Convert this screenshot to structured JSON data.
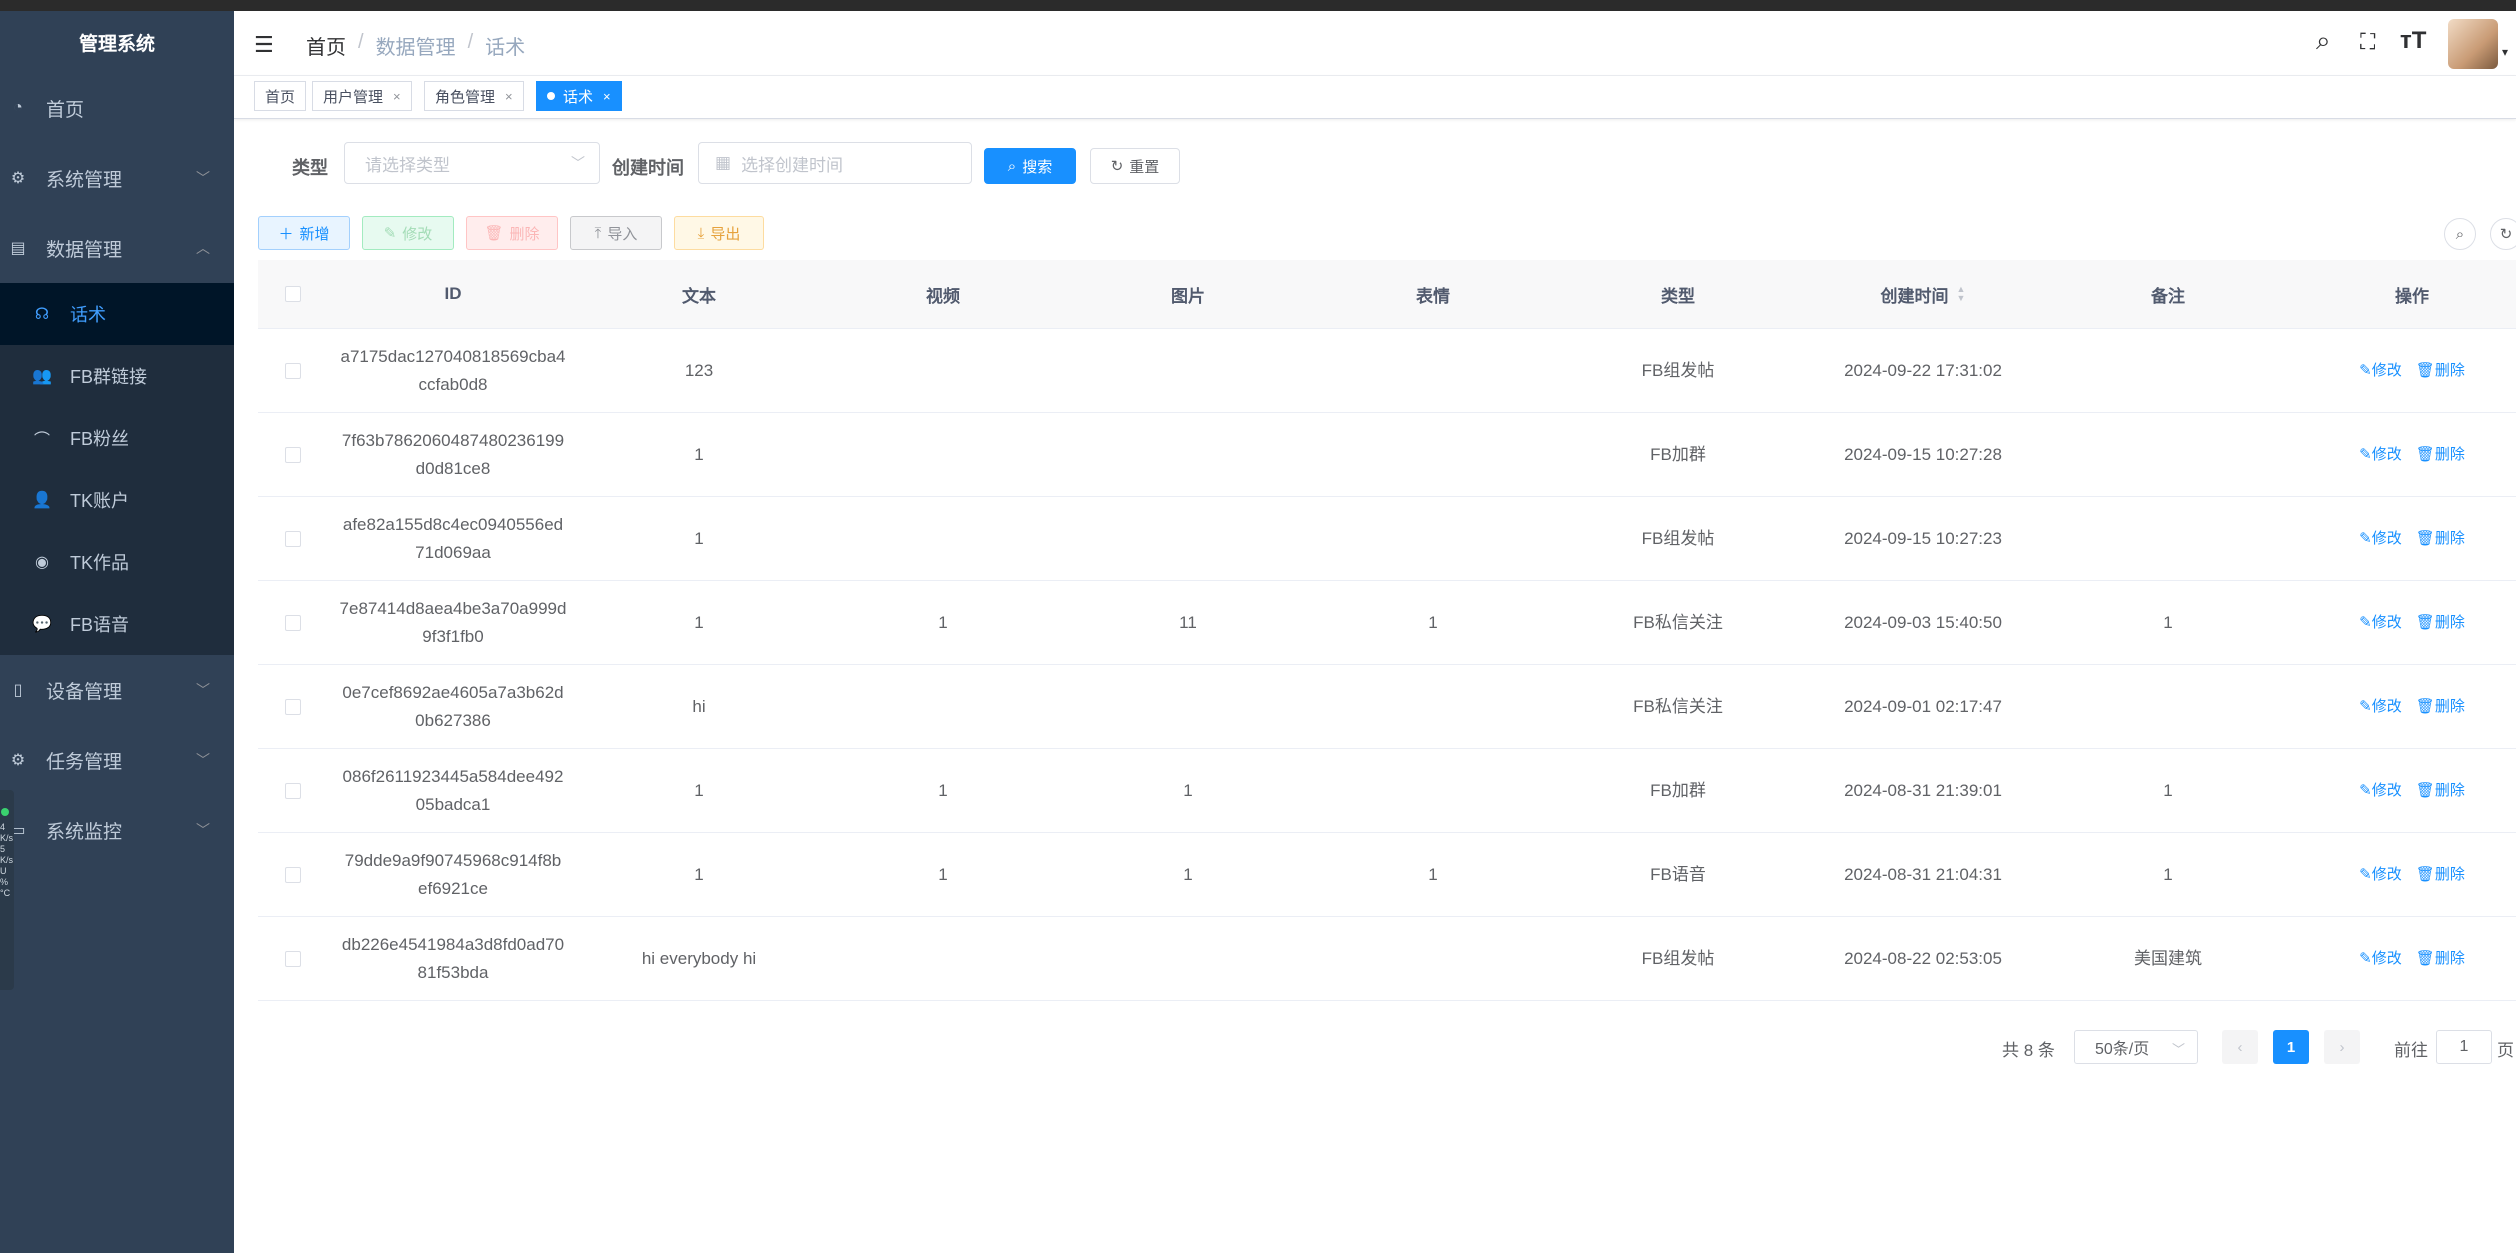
{
  "sidebar": {
    "logo": "管理系统",
    "items": [
      {
        "label": "首页",
        "icon": "dashboard-icon"
      },
      {
        "label": "系统管理",
        "icon": "gear-icon"
      },
      {
        "label": "数据管理",
        "icon": "database-icon"
      },
      {
        "label": "设备管理",
        "icon": "phone-icon"
      },
      {
        "label": "任务管理",
        "icon": "gear-icon"
      },
      {
        "label": "系统监控",
        "icon": "monitor-icon"
      }
    ],
    "submenu": [
      {
        "label": "话术",
        "icon": "chat-icon"
      },
      {
        "label": "FB群链接",
        "icon": "users-icon"
      },
      {
        "label": "FB粉丝",
        "icon": "link-icon"
      },
      {
        "label": "TK账户",
        "icon": "user-icon"
      },
      {
        "label": "TK作品",
        "icon": "eye-icon"
      },
      {
        "label": "FB语音",
        "icon": "chat-bubbles-icon"
      }
    ],
    "widget_lines": [
      "4",
      "K/s",
      "5",
      "K/s",
      "U",
      "%",
      "°C"
    ]
  },
  "header": {
    "breadcrumb": [
      "首页",
      "数据管理",
      "话术"
    ]
  },
  "tags": [
    {
      "label": "首页"
    },
    {
      "label": "用户管理",
      "close": "×"
    },
    {
      "label": "角色管理",
      "close": "×"
    },
    {
      "label": "话术",
      "close": "×"
    }
  ],
  "search": {
    "type_label": "类型",
    "type_placeholder": "请选择类型",
    "time_label": "创建时间",
    "time_placeholder": "选择创建时间",
    "search_btn": "搜索",
    "reset_btn": "重置"
  },
  "toolbar": {
    "add": "新增",
    "edit": "修改",
    "delete": "删除",
    "import": "导入",
    "export": "导出"
  },
  "table": {
    "headers": [
      "ID",
      "文本",
      "视频",
      "图片",
      "表情",
      "类型",
      "创建时间",
      "备注",
      "操作"
    ],
    "edit_label": "修改",
    "delete_label": "删除",
    "rows": [
      {
        "id1": "a7175dac127040818569cba4",
        "id2": "ccfab0d8",
        "text": "123",
        "video": "",
        "image": "",
        "emoji": "",
        "type": "FB组发帖",
        "time": "2024-09-22 17:31:02",
        "note": ""
      },
      {
        "id1": "7f63b7862060487480236199",
        "id2": "d0d81ce8",
        "text": "1",
        "video": "",
        "image": "",
        "emoji": "",
        "type": "FB加群",
        "time": "2024-09-15 10:27:28",
        "note": ""
      },
      {
        "id1": "afe82a155d8c4ec0940556ed",
        "id2": "71d069aa",
        "text": "1",
        "video": "",
        "image": "",
        "emoji": "",
        "type": "FB组发帖",
        "time": "2024-09-15 10:27:23",
        "note": ""
      },
      {
        "id1": "7e87414d8aea4be3a70a999d",
        "id2": "9f3f1fb0",
        "text": "1",
        "video": "1",
        "image": "11",
        "emoji": "1",
        "type": "FB私信关注",
        "time": "2024-09-03 15:40:50",
        "note": "1"
      },
      {
        "id1": "0e7cef8692ae4605a7a3b62d",
        "id2": "0b627386",
        "text": "hi",
        "video": "",
        "image": "",
        "emoji": "",
        "type": "FB私信关注",
        "time": "2024-09-01 02:17:47",
        "note": ""
      },
      {
        "id1": "086f2611923445a584dee492",
        "id2": "05badca1",
        "text": "1",
        "video": "1",
        "image": "1",
        "emoji": "",
        "type": "FB加群",
        "time": "2024-08-31 21:39:01",
        "note": "1"
      },
      {
        "id1": "79dde9a9f90745968c914f8b",
        "id2": "ef6921ce",
        "text": "1",
        "video": "1",
        "image": "1",
        "emoji": "1",
        "type": "FB语音",
        "time": "2024-08-31 21:04:31",
        "note": "1"
      },
      {
        "id1": "db226e4541984a3d8fd0ad70",
        "id2": "81f53bda",
        "text": "hi everybody hi",
        "video": "",
        "image": "",
        "emoji": "",
        "type": "FB组发帖",
        "time": "2024-08-22 02:53:05",
        "note": "美国建筑"
      }
    ]
  },
  "pagination": {
    "total": "共 8 条",
    "page_size": "50条/页",
    "current": "1",
    "goto_label": "前往",
    "goto_value": "1",
    "page_suffix": "页"
  },
  "colors": {
    "sidebar_bg": "#304156",
    "active_bg": "#001528",
    "primary": "#1890ff"
  }
}
